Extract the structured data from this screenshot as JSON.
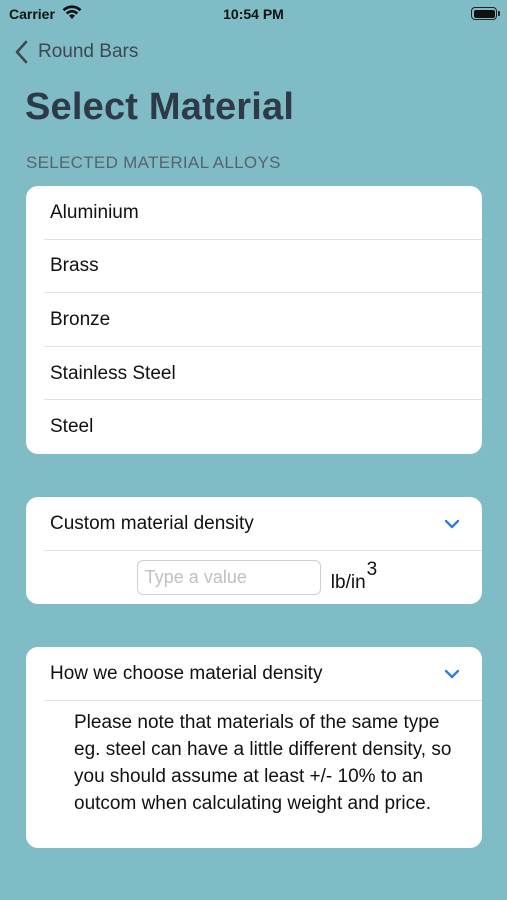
{
  "status_bar": {
    "carrier": "Carrier",
    "time": "10:54 PM",
    "battery_level": 1.0
  },
  "nav": {
    "back_label": "Round Bars"
  },
  "page": {
    "title": "Select Material",
    "section_header": "SELECTED MATERIAL ALLOYS"
  },
  "materials": [
    {
      "label": "Aluminium"
    },
    {
      "label": "Brass"
    },
    {
      "label": "Bronze"
    },
    {
      "label": "Stainless Steel"
    },
    {
      "label": "Steel"
    }
  ],
  "custom_density": {
    "label": "Custom material density",
    "input_placeholder": "Type a value",
    "input_value": "",
    "unit_base": "lb/in",
    "unit_exponent": "3"
  },
  "density_info": {
    "label": "How we choose material density",
    "text": "Please note that materials of the same type eg. steel can have a little different density, so you should assume at least +/- 10% to an outcom when calculating weight and price."
  },
  "colors": {
    "background": "#7fbcc6",
    "title": "#2e3a48",
    "accent": "#2f7fd6"
  },
  "icons": {
    "back": "chevron-left-icon",
    "disclosure": "chevron-down-icon",
    "wifi": "wifi-icon",
    "battery": "battery-icon"
  }
}
